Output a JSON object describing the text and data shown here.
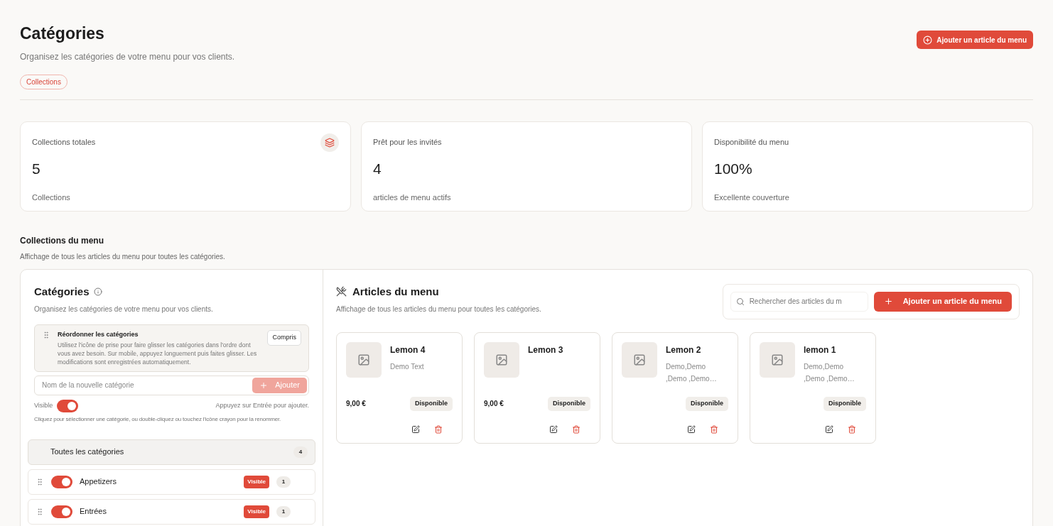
{
  "header": {
    "title": "Catégories",
    "subtitle": "Organisez les catégories de votre menu pour vos clients.",
    "tag": "Collections",
    "action": "Ajouter un article du menu"
  },
  "stats": [
    {
      "label": "Collections totales",
      "value": "5",
      "caption": "Collections",
      "icon": true
    },
    {
      "label": "Prêt pour les invités",
      "value": "4",
      "caption": "articles de menu actifs",
      "icon": false
    },
    {
      "label": "Disponibilité du menu",
      "value": "100%",
      "caption": "Excellente couverture",
      "icon": false
    }
  ],
  "section": {
    "title": "Collections du menu",
    "subtitle": "Affichage de tous les articles du menu pour toutes les catégories."
  },
  "categories_panel": {
    "title": "Catégories",
    "subtitle": "Organisez les catégories de votre menu pour vos clients.",
    "tip": {
      "title": "Réordonner les catégories",
      "text": "Utilisez l'icône de prise pour faire glisser les catégories dans l'ordre dont vous avez besoin. Sur mobile, appuyez longuement puis faites glisser. Les modifications sont enregistrées automatiquement.",
      "button": "Compris"
    },
    "new_field": {
      "placeholder": "Nom de la nouvelle catégorie",
      "button": "Ajouter",
      "disabled": true
    },
    "visible_label": "Visible",
    "visible_on": true,
    "enter_hint": "Appuyez sur Entrée pour ajouter.",
    "help": "Cliquez pour sélectionner une catégorie, ou double-cliquez ou touchez l'icône crayon pour la renommer.",
    "all": {
      "label": "Toutes les catégories",
      "count": "4",
      "selected": true
    },
    "items": [
      {
        "name": "Appetizers",
        "on": true,
        "badge": "Visible",
        "count": "1",
        "selected": false
      },
      {
        "name": "Entrées",
        "on": true,
        "badge": "Visible",
        "count": "1",
        "selected": false
      }
    ]
  },
  "items_panel": {
    "title": "Articles du menu",
    "subtitle": "Affichage de tous les articles du menu pour toutes les catégories.",
    "search_placeholder": "Rechercher des articles du m",
    "add": "Ajouter un article du menu",
    "items": [
      {
        "name": "Lemon 4",
        "description": "Demo Text",
        "price": "9,00 €",
        "status": "Disponible"
      },
      {
        "name": "Lemon 3",
        "price": "9,00 €",
        "status": "Disponible"
      },
      {
        "name": "Lemon 2",
        "description": "Demo,Demo ,Demo ,Demo…",
        "status": "Disponible"
      },
      {
        "name": "lemon 1",
        "description": "Demo,Demo ,Demo ,Demo…",
        "status": "Disponible"
      }
    ]
  }
}
